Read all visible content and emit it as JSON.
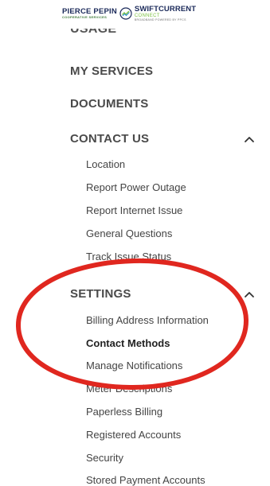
{
  "logo": {
    "left_brand": "PIERCE PEPIN",
    "left_sub": "COOPERATIVE SERVICES",
    "right_brand": "SWIFTCURRENT",
    "right_brand2": "CONNECT",
    "right_sub": "BROADBAND POWERED BY PPCS"
  },
  "nav": {
    "cut_item": "USAGE",
    "my_services": "MY SERVICES",
    "documents": "DOCUMENTS",
    "contact_us": {
      "label": "CONTACT US",
      "items": [
        "Location",
        "Report Power Outage",
        "Report Internet Issue",
        "General Questions",
        "Track Issue Status"
      ]
    },
    "settings": {
      "label": "SETTINGS",
      "items": [
        "Billing Address Information",
        "Contact Methods",
        "Manage Notifications",
        "Meter Descriptions",
        "Paperless Billing",
        "Registered Accounts",
        "Security",
        "Stored Payment Accounts"
      ],
      "active_index": 1
    }
  },
  "colors": {
    "highlight": "#e0271f",
    "text": "#444444",
    "brand_navy": "#1b2a5a",
    "brand_green": "#7cc243"
  },
  "icons": {
    "chevron": "chevron-up-icon"
  }
}
